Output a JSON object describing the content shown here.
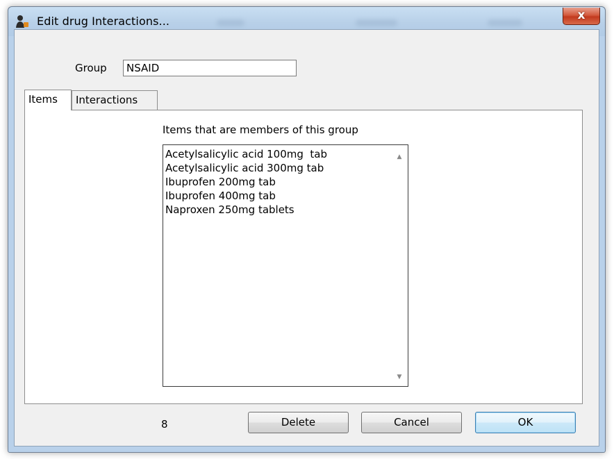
{
  "window": {
    "title": "Edit drug Interactions...",
    "close_label": "x"
  },
  "group": {
    "label": "Group",
    "value": "NSAID"
  },
  "tabs": [
    {
      "label": "Items",
      "selected": true
    },
    {
      "label": "Interactions",
      "selected": false
    }
  ],
  "items_panel": {
    "caption": "Items that are members of this group",
    "items": [
      "Acetylsalicylic acid 100mg  tab",
      "Acetylsalicylic acid 300mg tab",
      "Ibuprofen 200mg tab",
      "Ibuprofen 400mg tab",
      "Naproxen 250mg tablets"
    ]
  },
  "footer": {
    "count": "8",
    "delete_label": "Delete",
    "cancel_label": "Cancel",
    "ok_label": "OK"
  },
  "colors": {
    "frame": "#b9d1ea",
    "client": "#f0f0f0",
    "close_button": "#c7452a",
    "default_button_border": "#3c7fb1"
  }
}
